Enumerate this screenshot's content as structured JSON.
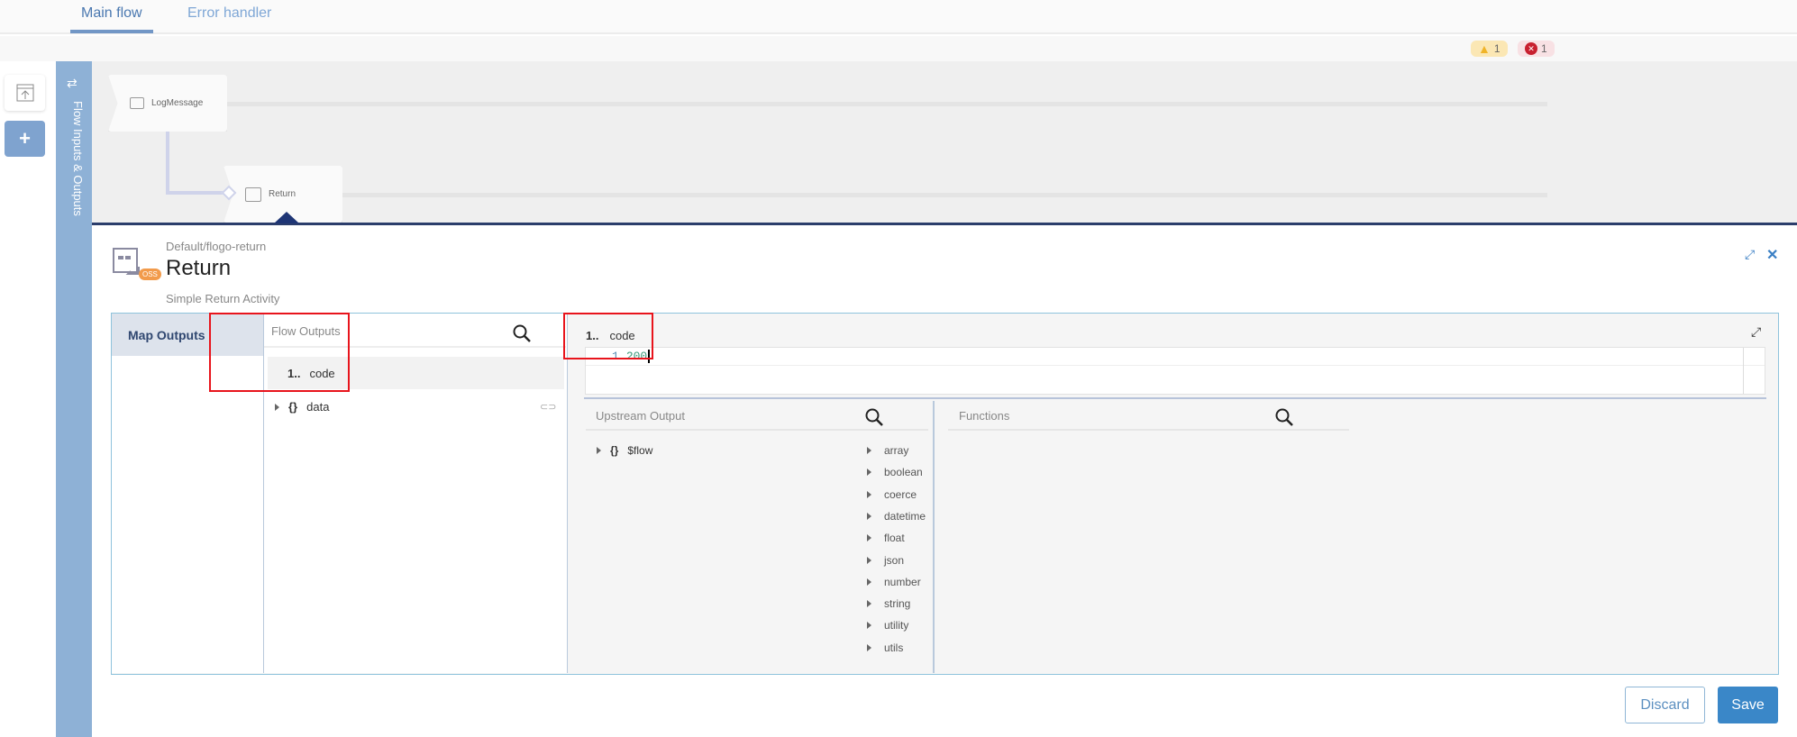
{
  "tabs": [
    {
      "label": "Main flow",
      "active": true
    },
    {
      "label": "Error handler",
      "active": false
    }
  ],
  "status": {
    "warnings": "1",
    "errors": "1",
    "warning_color": "#f0b429",
    "error_color": "#c8202f"
  },
  "sidebar": {
    "label": "Flow Inputs & Outputs"
  },
  "flow": {
    "nodes": [
      {
        "label": "LogMessage"
      },
      {
        "label": "Return"
      }
    ]
  },
  "detail": {
    "ref": "Default/flogo-return",
    "title": "Return",
    "description": "Simple Return Activity",
    "badge": "OSS"
  },
  "mapper": {
    "nav": "Map Outputs",
    "flow_outputs": {
      "title": "Flow Outputs",
      "items": [
        {
          "prefix": "1..",
          "name": "code"
        },
        {
          "prefix": "{}",
          "name": "data"
        }
      ]
    },
    "editor": {
      "field_prefix": "1..",
      "field": "code",
      "line": "1",
      "value": "200"
    },
    "upstream": {
      "title": "Upstream Output",
      "items": [
        {
          "prefix": "{}",
          "name": "$flow"
        }
      ]
    },
    "functions": {
      "title": "Functions",
      "items": [
        "array",
        "boolean",
        "coerce",
        "datetime",
        "float",
        "json",
        "number",
        "string",
        "utility",
        "utils"
      ]
    }
  },
  "buttons": {
    "discard": "Discard",
    "save": "Save"
  }
}
